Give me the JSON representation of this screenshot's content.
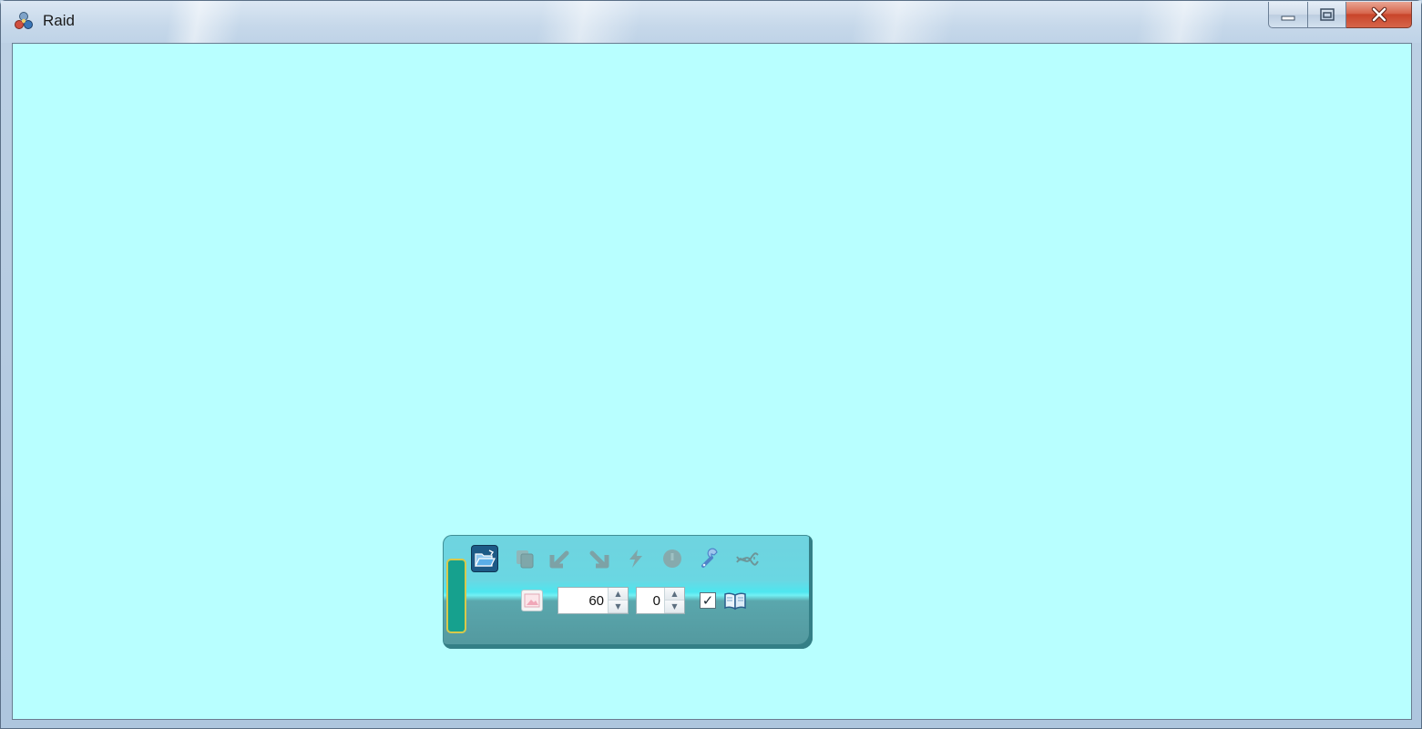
{
  "window": {
    "title": "Raid",
    "app_icon": "raid-app-icon",
    "buttons": [
      "minimize-icon",
      "maximize-icon",
      "close-icon"
    ]
  },
  "client": {
    "background": "#b8ffff"
  },
  "toolbar": {
    "top_icons": [
      "folder-open-icon",
      "copy-icon",
      "undo-icon",
      "redo-icon",
      "lightning-icon",
      "stop-icon",
      "wrench-icon",
      "dna-icon"
    ],
    "image_button_icon": "image-icon",
    "spin1": {
      "value": "60"
    },
    "spin2": {
      "value": "0"
    },
    "checkbox": {
      "checked": true,
      "mark": "✓"
    },
    "book_icon": "book-icon"
  }
}
